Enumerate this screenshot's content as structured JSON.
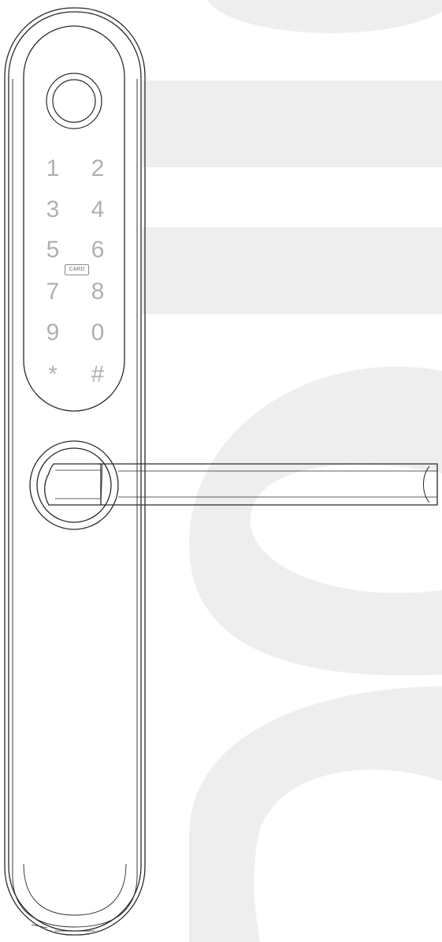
{
  "keypad": {
    "keys": [
      "1",
      "2",
      "3",
      "4",
      "5",
      "6",
      "7",
      "8",
      "9",
      "0",
      "*",
      "#"
    ],
    "card_label": "CARD"
  },
  "colors": {
    "background": "#ffffff",
    "watermark": "#eeeeee",
    "outline": "#2a2a2a",
    "key_text": "#b0b0b0"
  },
  "icons": {
    "fingerprint_sensor": "fingerprint-sensor-icon",
    "card_reader": "card-reader-icon"
  }
}
